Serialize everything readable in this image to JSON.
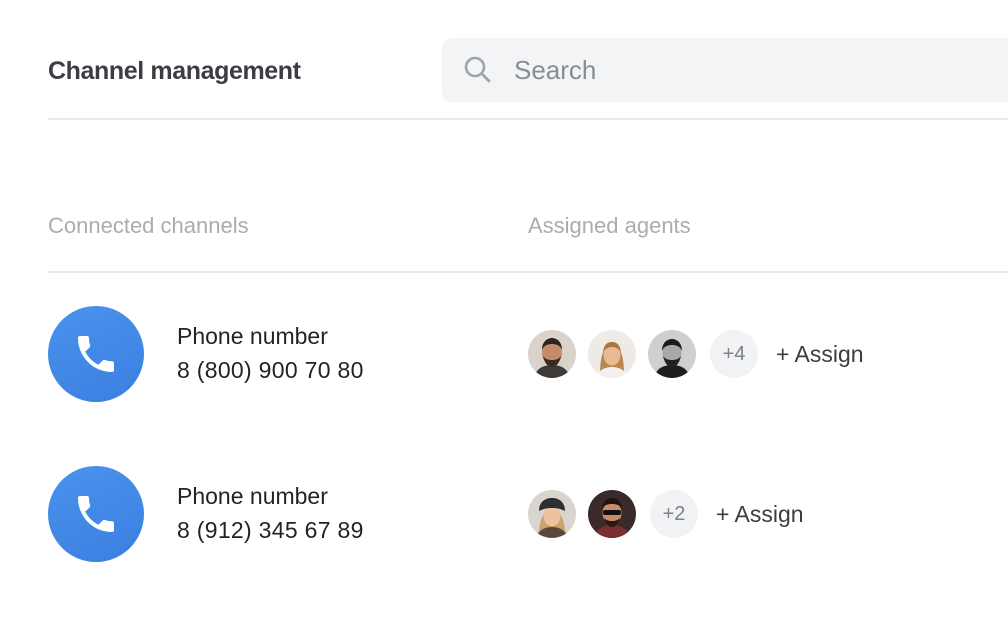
{
  "header": {
    "title": "Channel management",
    "search": {
      "placeholder": "Search",
      "value": ""
    }
  },
  "table": {
    "columns": [
      "Connected channels",
      "Assigned agents"
    ],
    "rows": [
      {
        "channel_type": "Phone number",
        "number": "8 (800) 900 70 80",
        "icon": "phone-icon",
        "agents": [
          "agent-avatar",
          "agent-avatar",
          "agent-avatar"
        ],
        "more": "+4",
        "assign_label": "+ Assign"
      },
      {
        "channel_type": "Phone number",
        "number": "8 (912) 345 67 89",
        "icon": "phone-icon",
        "agents": [
          "agent-avatar",
          "agent-avatar"
        ],
        "more": "+2",
        "assign_label": "+ Assign"
      }
    ]
  },
  "colors": {
    "accent": "#3b82e6",
    "title_text": "#3a3d42",
    "muted_text": "#a9adb2",
    "search_bg": "#f3f4f6",
    "divider": "#e8e9eb"
  }
}
